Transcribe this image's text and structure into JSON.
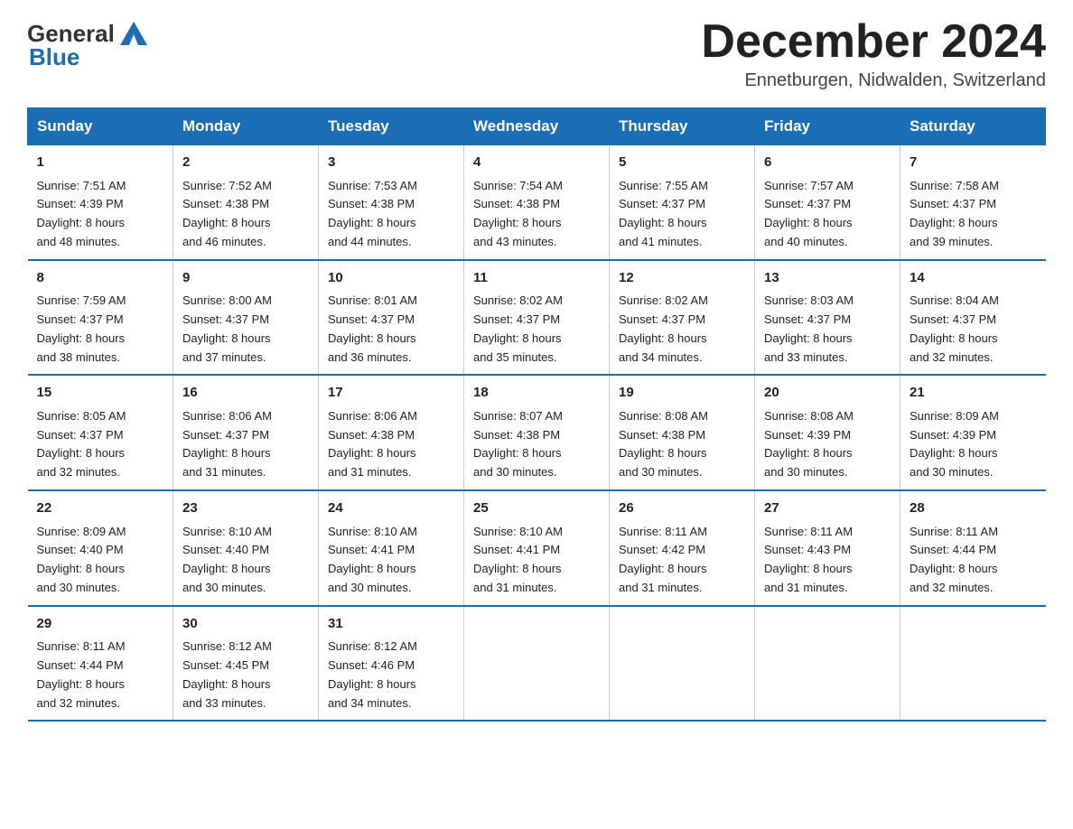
{
  "header": {
    "logo_text_black": "General",
    "logo_text_blue": "Blue",
    "month_title": "December 2024",
    "location": "Ennetburgen, Nidwalden, Switzerland"
  },
  "days_of_week": [
    "Sunday",
    "Monday",
    "Tuesday",
    "Wednesday",
    "Thursday",
    "Friday",
    "Saturday"
  ],
  "weeks": [
    [
      {
        "day": "1",
        "sunrise": "7:51 AM",
        "sunset": "4:39 PM",
        "daylight": "8 hours and 48 minutes."
      },
      {
        "day": "2",
        "sunrise": "7:52 AM",
        "sunset": "4:38 PM",
        "daylight": "8 hours and 46 minutes."
      },
      {
        "day": "3",
        "sunrise": "7:53 AM",
        "sunset": "4:38 PM",
        "daylight": "8 hours and 44 minutes."
      },
      {
        "day": "4",
        "sunrise": "7:54 AM",
        "sunset": "4:38 PM",
        "daylight": "8 hours and 43 minutes."
      },
      {
        "day": "5",
        "sunrise": "7:55 AM",
        "sunset": "4:37 PM",
        "daylight": "8 hours and 41 minutes."
      },
      {
        "day": "6",
        "sunrise": "7:57 AM",
        "sunset": "4:37 PM",
        "daylight": "8 hours and 40 minutes."
      },
      {
        "day": "7",
        "sunrise": "7:58 AM",
        "sunset": "4:37 PM",
        "daylight": "8 hours and 39 minutes."
      }
    ],
    [
      {
        "day": "8",
        "sunrise": "7:59 AM",
        "sunset": "4:37 PM",
        "daylight": "8 hours and 38 minutes."
      },
      {
        "day": "9",
        "sunrise": "8:00 AM",
        "sunset": "4:37 PM",
        "daylight": "8 hours and 37 minutes."
      },
      {
        "day": "10",
        "sunrise": "8:01 AM",
        "sunset": "4:37 PM",
        "daylight": "8 hours and 36 minutes."
      },
      {
        "day": "11",
        "sunrise": "8:02 AM",
        "sunset": "4:37 PM",
        "daylight": "8 hours and 35 minutes."
      },
      {
        "day": "12",
        "sunrise": "8:02 AM",
        "sunset": "4:37 PM",
        "daylight": "8 hours and 34 minutes."
      },
      {
        "day": "13",
        "sunrise": "8:03 AM",
        "sunset": "4:37 PM",
        "daylight": "8 hours and 33 minutes."
      },
      {
        "day": "14",
        "sunrise": "8:04 AM",
        "sunset": "4:37 PM",
        "daylight": "8 hours and 32 minutes."
      }
    ],
    [
      {
        "day": "15",
        "sunrise": "8:05 AM",
        "sunset": "4:37 PM",
        "daylight": "8 hours and 32 minutes."
      },
      {
        "day": "16",
        "sunrise": "8:06 AM",
        "sunset": "4:37 PM",
        "daylight": "8 hours and 31 minutes."
      },
      {
        "day": "17",
        "sunrise": "8:06 AM",
        "sunset": "4:38 PM",
        "daylight": "8 hours and 31 minutes."
      },
      {
        "day": "18",
        "sunrise": "8:07 AM",
        "sunset": "4:38 PM",
        "daylight": "8 hours and 30 minutes."
      },
      {
        "day": "19",
        "sunrise": "8:08 AM",
        "sunset": "4:38 PM",
        "daylight": "8 hours and 30 minutes."
      },
      {
        "day": "20",
        "sunrise": "8:08 AM",
        "sunset": "4:39 PM",
        "daylight": "8 hours and 30 minutes."
      },
      {
        "day": "21",
        "sunrise": "8:09 AM",
        "sunset": "4:39 PM",
        "daylight": "8 hours and 30 minutes."
      }
    ],
    [
      {
        "day": "22",
        "sunrise": "8:09 AM",
        "sunset": "4:40 PM",
        "daylight": "8 hours and 30 minutes."
      },
      {
        "day": "23",
        "sunrise": "8:10 AM",
        "sunset": "4:40 PM",
        "daylight": "8 hours and 30 minutes."
      },
      {
        "day": "24",
        "sunrise": "8:10 AM",
        "sunset": "4:41 PM",
        "daylight": "8 hours and 30 minutes."
      },
      {
        "day": "25",
        "sunrise": "8:10 AM",
        "sunset": "4:41 PM",
        "daylight": "8 hours and 31 minutes."
      },
      {
        "day": "26",
        "sunrise": "8:11 AM",
        "sunset": "4:42 PM",
        "daylight": "8 hours and 31 minutes."
      },
      {
        "day": "27",
        "sunrise": "8:11 AM",
        "sunset": "4:43 PM",
        "daylight": "8 hours and 31 minutes."
      },
      {
        "day": "28",
        "sunrise": "8:11 AM",
        "sunset": "4:44 PM",
        "daylight": "8 hours and 32 minutes."
      }
    ],
    [
      {
        "day": "29",
        "sunrise": "8:11 AM",
        "sunset": "4:44 PM",
        "daylight": "8 hours and 32 minutes."
      },
      {
        "day": "30",
        "sunrise": "8:12 AM",
        "sunset": "4:45 PM",
        "daylight": "8 hours and 33 minutes."
      },
      {
        "day": "31",
        "sunrise": "8:12 AM",
        "sunset": "4:46 PM",
        "daylight": "8 hours and 34 minutes."
      },
      null,
      null,
      null,
      null
    ]
  ],
  "labels": {
    "sunrise": "Sunrise:",
    "sunset": "Sunset:",
    "daylight": "Daylight:"
  }
}
